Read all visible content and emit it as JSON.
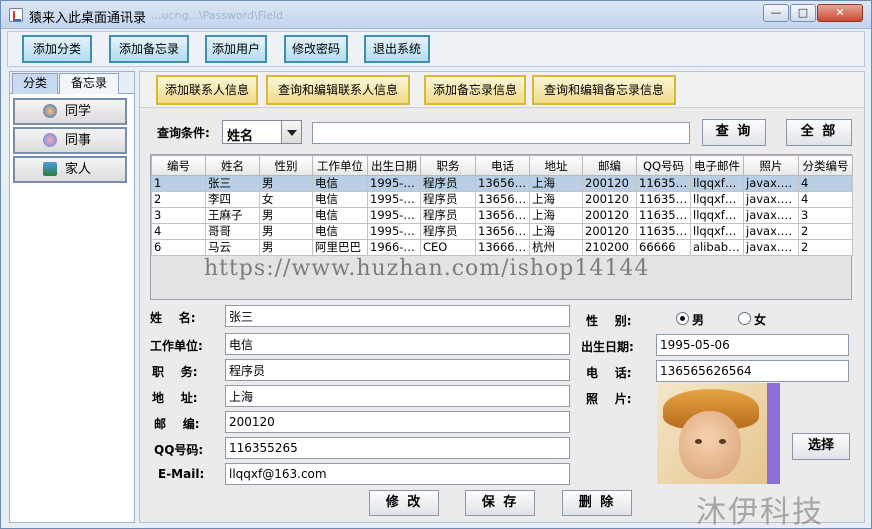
{
  "window": {
    "title": "猿来入此桌面通讯录",
    "ghost_text": "...ucng...\\Password\\Field",
    "min_glyph": "—",
    "max_glyph": "□",
    "close_glyph": "✕"
  },
  "toolbar": [
    "添加分类",
    "添加备忘录",
    "添加用户",
    "修改密码",
    "退出系统"
  ],
  "left_tabs": [
    "分类",
    "备忘录"
  ],
  "categories": [
    "同学",
    "同事",
    "家人"
  ],
  "subbar": [
    "添加联系人信息",
    "查询和编辑联系人信息",
    "添加备忘录信息",
    "查询和编辑备忘录信息"
  ],
  "query": {
    "label": "查询条件:",
    "field": "姓名",
    "value": "",
    "search_btn": "查 询",
    "all_btn": "全 部"
  },
  "table": {
    "headers": [
      "编号",
      "姓名",
      "性别",
      "工作单位",
      "出生日期",
      "职务",
      "电话",
      "地址",
      "邮编",
      "QQ号码",
      "电子邮件",
      "照片",
      "分类编号"
    ],
    "rows": [
      [
        "1",
        "张三",
        "男",
        "电信",
        "1995-0...",
        "程序员",
        "136565...",
        "上海",
        "200120",
        "116355...",
        "llqqxf@...",
        "javax.s...",
        "4"
      ],
      [
        "2",
        "李四",
        "女",
        "电信",
        "1995-0...",
        "程序员",
        "136565...",
        "上海",
        "200120",
        "116355...",
        "llqqxf@...",
        "javax.s...",
        "4"
      ],
      [
        "3",
        "王麻子",
        "男",
        "电信",
        "1995-0...",
        "程序员",
        "136565...",
        "上海",
        "200120",
        "116355...",
        "llqqxf@...",
        "javax.s...",
        "3"
      ],
      [
        "4",
        "哥哥",
        "男",
        "电信",
        "1995-0...",
        "程序员",
        "136565...",
        "上海",
        "200120",
        "116355...",
        "llqqxf@...",
        "javax.s...",
        "2"
      ],
      [
        "6",
        "马云",
        "男",
        "阿里巴巴",
        "1966-0...",
        "CEO",
        "136666...",
        "杭州",
        "210200",
        "66666",
        "alibaba...",
        "javax.s...",
        "2"
      ]
    ]
  },
  "watermark": "https://www.huzhan.com/ishop14144",
  "form": {
    "name_label": "姓    名:",
    "name": "张三",
    "company_label": "工作单位:",
    "company": "电信",
    "position_label": "职    务:",
    "position": "程序员",
    "address_label": "地    址:",
    "address": "上海",
    "zip_label": "邮    编:",
    "zip": "200120",
    "qq_label": "QQ号码:",
    "qq": "116355265",
    "email_label": "E-Mail:",
    "email": "llqqxf@163.com",
    "gender_label": "性    别:",
    "male": "男",
    "female": "女",
    "birth_label": "出生日期:",
    "birth": "1995-05-06",
    "phone_label": "电    话:",
    "phone": "136565626564",
    "photo_label": "照    片:",
    "choose_btn": "选择"
  },
  "actions": [
    "修 改",
    "保 存",
    "删 除"
  ],
  "corner_watermark": "沐伊科技"
}
